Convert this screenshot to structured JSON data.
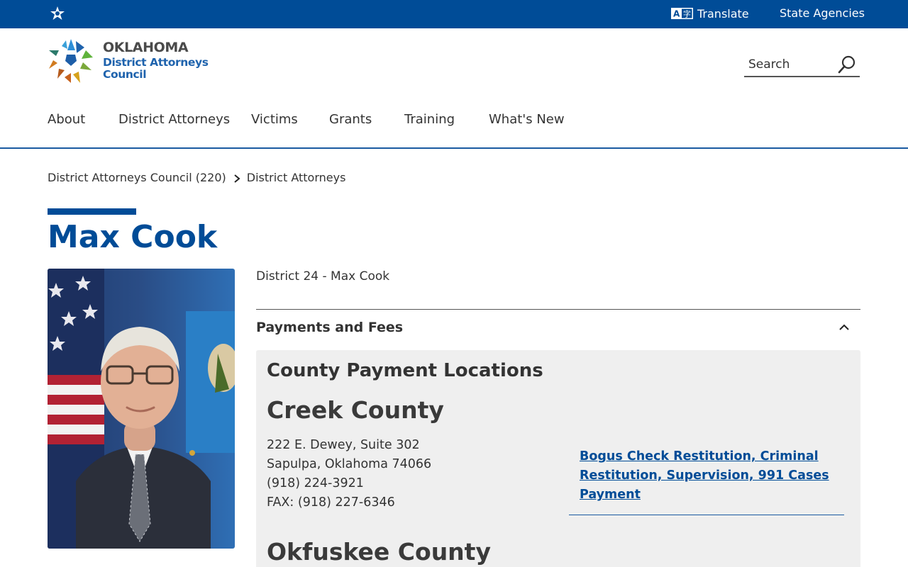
{
  "topbar": {
    "translate_label": "Translate",
    "state_agencies_label": "State Agencies"
  },
  "logo": {
    "line1": "OKLAHOMA",
    "line2": "District Attorneys",
    "line3": "Council"
  },
  "search": {
    "label": "Search"
  },
  "nav": {
    "items": [
      "About",
      "District Attorneys",
      "Victims",
      "Grants",
      "Training",
      "What's New"
    ]
  },
  "breadcrumb": {
    "items": [
      "District Attorneys Council (220)",
      "District Attorneys"
    ]
  },
  "page": {
    "title": "Max Cook",
    "district_line": "District 24 - Max Cook"
  },
  "accordion": {
    "title": "Payments and Fees",
    "panel_heading": "County Payment Locations",
    "counties": [
      {
        "name": "Creek County",
        "address_lines": [
          "222 E. Dewey, Suite 302",
          "Sapulpa, Oklahoma 74066",
          "(918) 224-3921",
          "FAX: (918) 227-6346"
        ],
        "link": "Bogus Check Restitution, Criminal Restitution, Supervision, 991 Cases Payment"
      },
      {
        "name": "Okfuskee County"
      }
    ]
  },
  "colors": {
    "brand_blue": "#004c97",
    "panel_bg": "#efefef"
  }
}
